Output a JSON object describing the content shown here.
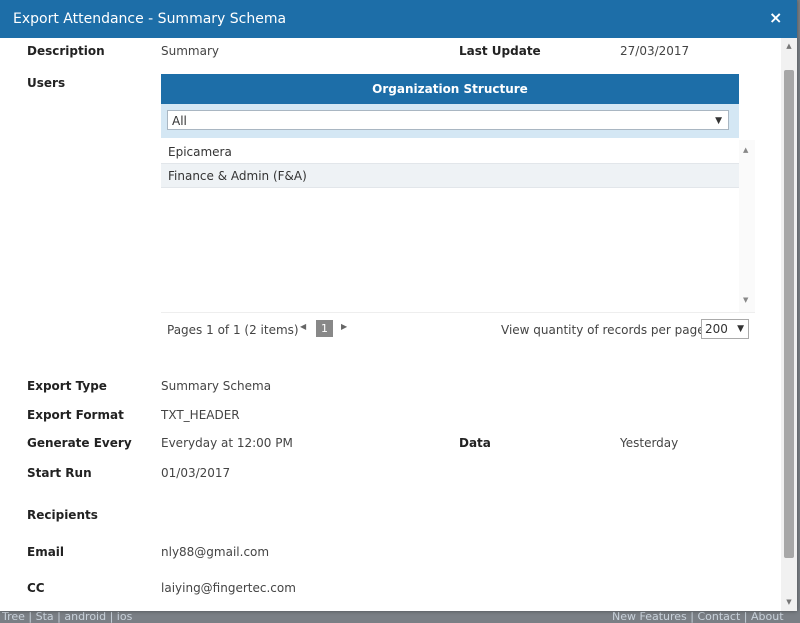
{
  "background": {
    "left_links": "Tree  |  Sta  |  android  |  ios",
    "right_links": "New Features  |  Contact  |  About"
  },
  "dialog": {
    "title": "Export Attendance - Summary Schema",
    "close_symbol": "×"
  },
  "fields": {
    "description_label": "Description",
    "description_value": "Summary",
    "last_update_label": "Last Update",
    "last_update_value": "27/03/2017",
    "users_label": "Users",
    "export_type_label": "Export Type",
    "export_type_value": "Summary Schema",
    "export_format_label": "Export Format",
    "export_format_value": "TXT_HEADER",
    "generate_every_label": "Generate Every",
    "generate_every_value": "Everyday at 12:00 PM",
    "data_label": "Data",
    "data_value": "Yesterday",
    "start_run_label": "Start Run",
    "start_run_value": "01/03/2017",
    "recipients_label": "Recipients",
    "email_label": "Email",
    "email_value": "nly88@gmail.com",
    "cc_label": "CC",
    "cc_value": "laiying@fingertec.com"
  },
  "org": {
    "header": "Organization Structure",
    "select_value": "All",
    "items": [
      "Epicamera",
      "Finance & Admin (F&A)"
    ]
  },
  "pager": {
    "info": "Pages 1 of 1 (2 items)",
    "current_page": "1",
    "qty_label": "View quantity of records per page",
    "qty_value": "200"
  },
  "icons": {
    "close": "close-icon",
    "dropdown": "chevron-down-icon",
    "prev": "prev-page-icon",
    "next": "next-page-icon"
  },
  "colors": {
    "header_blue": "#1d6ea8",
    "select_band": "#d4e7f4"
  }
}
